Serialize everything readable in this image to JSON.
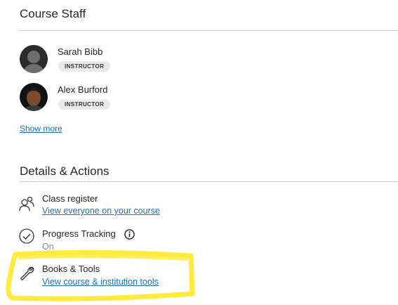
{
  "staff": {
    "title": "Course Staff",
    "members": [
      {
        "name": "Sarah Bibb",
        "role": "INSTRUCTOR"
      },
      {
        "name": "Alex Burford",
        "role": "INSTRUCTOR"
      }
    ],
    "show_more": "Show more"
  },
  "details": {
    "title": "Details & Actions",
    "class_register": {
      "label": "Class register",
      "link": "View everyone on your course",
      "icon": "people-icon"
    },
    "progress": {
      "label": "Progress Tracking",
      "status": "On",
      "icon": "check-circle-icon"
    },
    "books": {
      "label": "Books & Tools",
      "link": "View course & institution tools",
      "icon": "wrench-icon"
    }
  },
  "colors": {
    "link": "#1a6fbf",
    "highlight": "#ffeb3b",
    "badge_bg": "#eaeaea"
  }
}
